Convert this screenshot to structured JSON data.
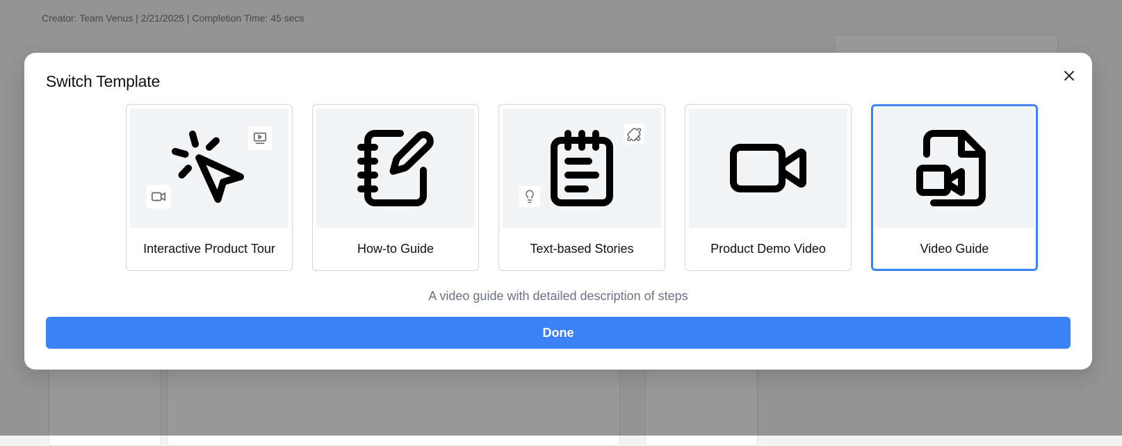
{
  "background": {
    "header_text": "Creator: Team Venus | 2/21/2025 | Completion Time: 45 secs"
  },
  "modal": {
    "title": "Switch Template",
    "close_icon": "close-icon",
    "templates": [
      {
        "label": "Interactive Product Tour",
        "icon": "cursor-click-icon",
        "badges": [
          "presentation-icon",
          "video-camera-icon"
        ],
        "selected": false
      },
      {
        "label": "How-to Guide",
        "icon": "notebook-pen-icon",
        "badges": [],
        "selected": false
      },
      {
        "label": "Text-based Stories",
        "icon": "notepad-text-icon",
        "badges": [
          "puzzle-icon",
          "lightbulb-icon"
        ],
        "selected": false
      },
      {
        "label": "Product Demo Video",
        "icon": "video-camera-icon",
        "badges": [],
        "selected": false
      },
      {
        "label": "Video Guide",
        "icon": "file-video-icon",
        "badges": [],
        "selected": true
      }
    ],
    "description": "A video guide with detailed description of steps",
    "done_label": "Done"
  },
  "colors": {
    "accent": "#3b82f6",
    "card_bg": "#f3f4f6",
    "description_text": "#6b7280",
    "overlay": "rgba(0,0,0,0.40)"
  }
}
